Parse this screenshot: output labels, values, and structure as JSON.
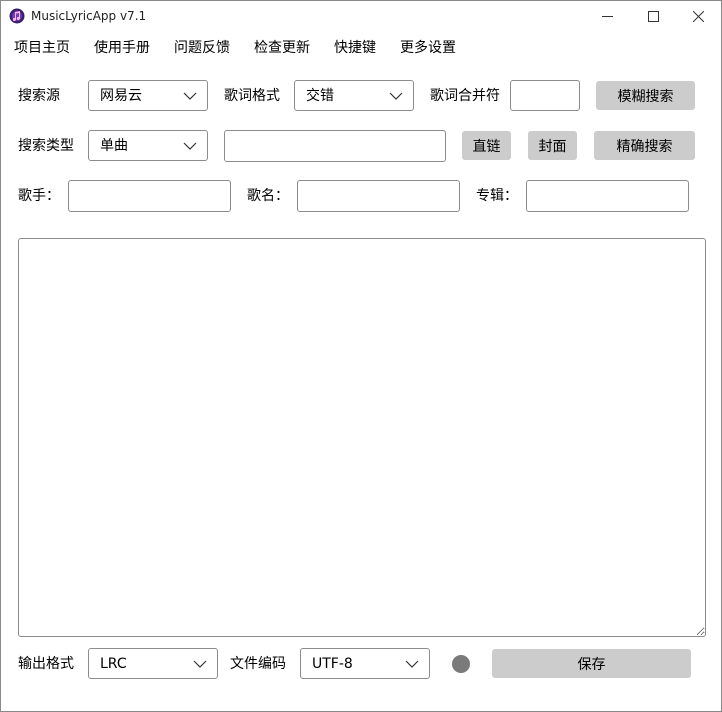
{
  "window": {
    "title": "MusicLyricApp v7.1"
  },
  "menu": {
    "items": [
      "项目主页",
      "使用手册",
      "问题反馈",
      "检查更新",
      "快捷键",
      "更多设置"
    ]
  },
  "row1": {
    "search_source_label": "搜索源",
    "search_source_value": "网易云",
    "lyric_format_label": "歌词格式",
    "lyric_format_value": "交错",
    "merge_char_label": "歌词合并符",
    "merge_char_value": "",
    "fuzzy_search_label": "模糊搜索"
  },
  "row2": {
    "search_type_label": "搜索类型",
    "search_type_value": "单曲",
    "search_input_value": "",
    "direct_link_label": "直链",
    "cover_label": "封面",
    "exact_search_label": "精确搜索"
  },
  "row3": {
    "singer_label": "歌手：",
    "singer_value": "",
    "song_label": "歌名：",
    "song_value": "",
    "album_label": "专辑：",
    "album_value": ""
  },
  "lyrics": {
    "content": ""
  },
  "bottom": {
    "output_format_label": "输出格式",
    "output_format_value": "LRC",
    "encoding_label": "文件编码",
    "encoding_value": "UTF-8",
    "save_label": "保存",
    "status_color": "#7a7a7a"
  },
  "colors": {
    "button_bg": "#cccccc",
    "border": "#8c8c8c"
  }
}
